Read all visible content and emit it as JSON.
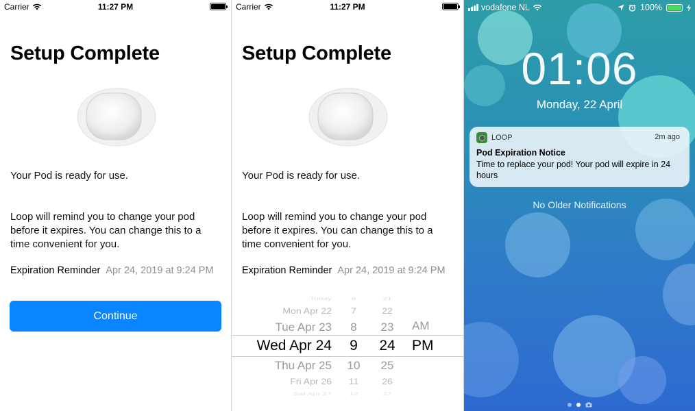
{
  "screen1": {
    "status": {
      "carrier": "Carrier",
      "time": "11:27 PM"
    },
    "title": "Setup Complete",
    "ready_text": "Your Pod is ready for use.",
    "remind_text": "Loop will remind you to change your pod before it expires. You can change this to a time convenient for you.",
    "reminder_label": "Expiration Reminder",
    "reminder_value": "Apr 24, 2019 at 9:24 PM",
    "continue_label": "Continue",
    "colors": {
      "accent": "#0a84ff"
    }
  },
  "screen2": {
    "status": {
      "carrier": "Carrier",
      "time": "11:27 PM"
    },
    "title": "Setup Complete",
    "ready_text": "Your Pod is ready for use.",
    "remind_text": "Loop will remind you to change your pod before it expires. You can change this to a time convenient for you.",
    "reminder_label": "Expiration Reminder",
    "reminder_value": "Apr 24, 2019 at 9:24 PM",
    "picker": {
      "dates": [
        "Today",
        "Mon Apr 22",
        "Tue Apr 23",
        "Wed Apr 24",
        "Thu Apr 25",
        "Fri Apr 26",
        "Sat Apr 27"
      ],
      "hours": [
        "6",
        "7",
        "8",
        "9",
        "10",
        "11",
        "12"
      ],
      "minutes": [
        "21",
        "22",
        "23",
        "24",
        "25",
        "26",
        "27"
      ],
      "meridiem": [
        "AM",
        "PM"
      ],
      "selected": {
        "date": "Wed Apr 24",
        "hour": "9",
        "minute": "24",
        "meridiem": "PM"
      }
    }
  },
  "screen3": {
    "status": {
      "carrier": "vodafone NL",
      "battery": "100%"
    },
    "clock": "01:06",
    "date": "Monday, 22 April",
    "notification": {
      "app": "LOOP",
      "time": "2m ago",
      "title": "Pod Expiration Notice",
      "body": "Time to replace your pod! Your pod will expire in 24 hours"
    },
    "no_older": "No Older Notifications",
    "colors": {
      "battery": "#4cd964",
      "app_icon": "#3b8c3b"
    }
  }
}
